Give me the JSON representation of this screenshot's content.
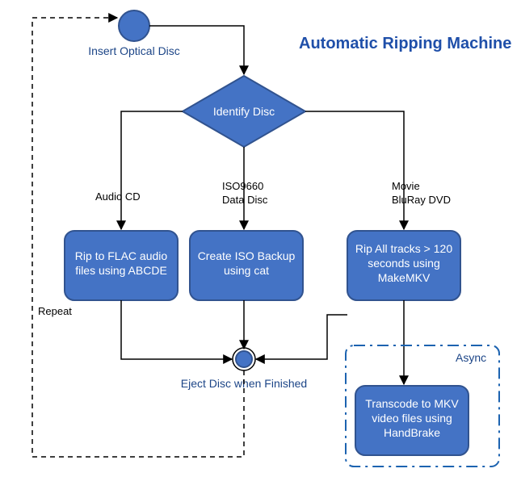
{
  "chart_data": {
    "type": "flowchart",
    "title": "Automatic Ripping Machine",
    "nodes": [
      {
        "id": "start",
        "kind": "start",
        "label": "Insert Optical Disc"
      },
      {
        "id": "identify",
        "kind": "decision",
        "label": "Identify Disc"
      },
      {
        "id": "flac",
        "kind": "process",
        "label": "Rip to FLAC audio files using ABCDE"
      },
      {
        "id": "iso",
        "kind": "process",
        "label": "Create ISO Backup using cat"
      },
      {
        "id": "mkv",
        "kind": "process",
        "label": "Rip All tracks > 120 seconds using MakeMKV"
      },
      {
        "id": "eject",
        "kind": "connector",
        "label": "Eject Disc when Finished"
      },
      {
        "id": "hb",
        "kind": "process",
        "label": "Transcode to MKV video files using HandBrake"
      }
    ],
    "edges": [
      {
        "from": "start",
        "to": "identify"
      },
      {
        "from": "identify",
        "to": "flac",
        "label": "Audio CD"
      },
      {
        "from": "identify",
        "to": "iso",
        "label": "ISO9660 Data Disc"
      },
      {
        "from": "identify",
        "to": "mkv",
        "label": "Movie BluRay DVD"
      },
      {
        "from": "flac",
        "to": "eject"
      },
      {
        "from": "iso",
        "to": "eject"
      },
      {
        "from": "mkv",
        "to": "eject"
      },
      {
        "from": "mkv",
        "to": "hb",
        "label": "Async"
      },
      {
        "from": "eject",
        "to": "start",
        "label": "Repeat",
        "style": "dashed"
      }
    ]
  },
  "title": "Automatic Ripping Machine",
  "start_label": "Insert Optical Disc",
  "identify_label": "Identify Disc",
  "branch_audio": "Audio CD",
  "branch_iso_l1": "ISO9660",
  "branch_iso_l2": "Data Disc",
  "branch_movie_l1": "Movie",
  "branch_movie_l2": "BluRay DVD",
  "flac_l1": "Rip to FLAC audio",
  "flac_l2": "files using ABCDE",
  "iso_l1": "Create ISO Backup",
  "iso_l2": "using cat",
  "mkv_l1": "Rip All tracks > 120",
  "mkv_l2": "seconds using",
  "mkv_l3": "MakeMKV",
  "eject_label": "Eject Disc when Finished",
  "async_label": "Async",
  "hb_l1": "Transcode to MKV",
  "hb_l2": "video files using",
  "hb_l3": "HandBrake",
  "repeat_label": "Repeat"
}
